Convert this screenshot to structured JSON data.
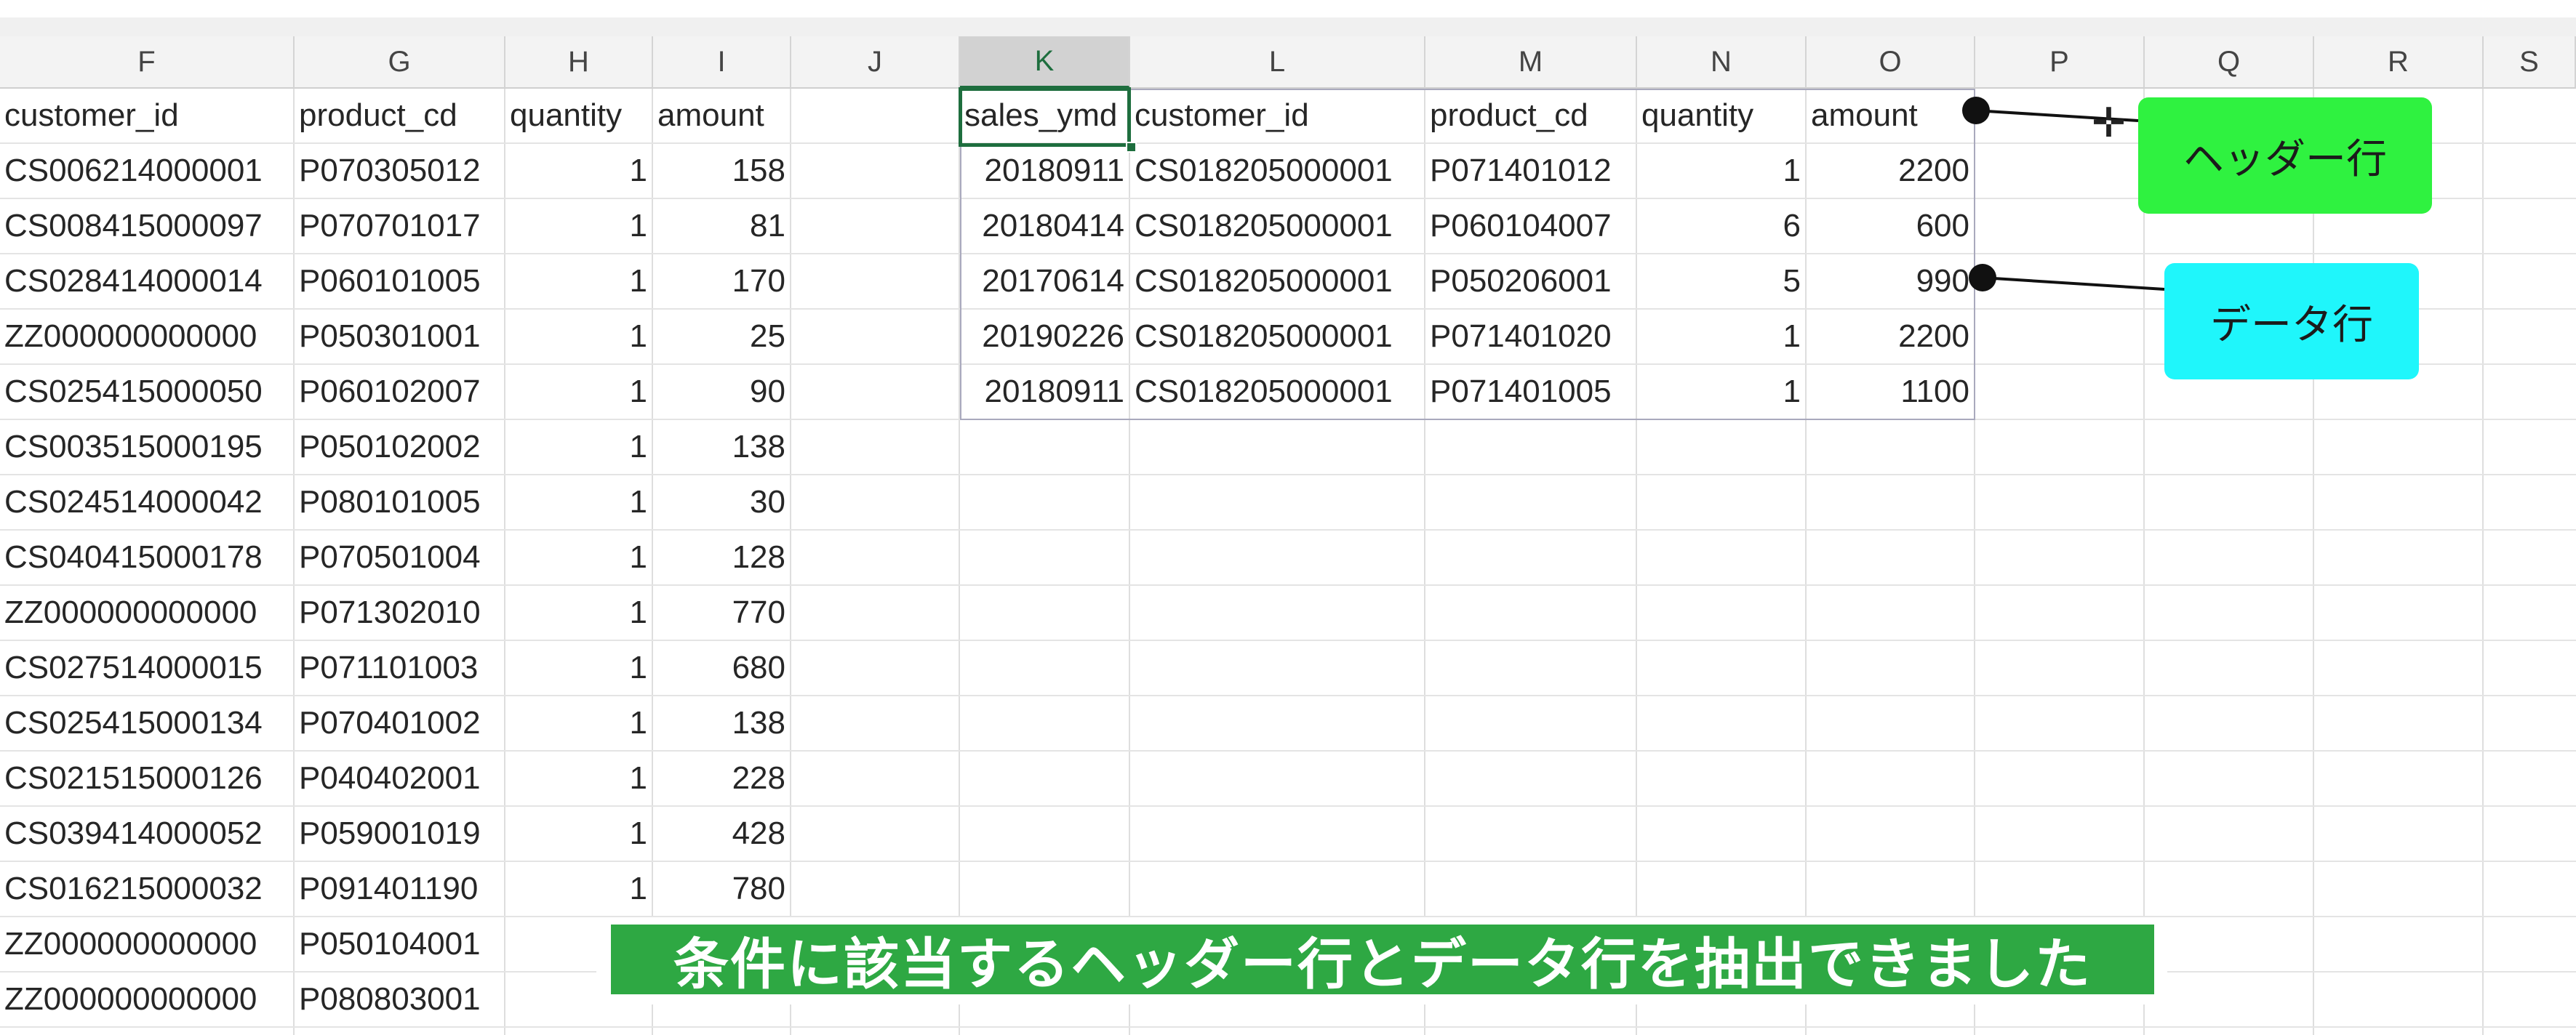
{
  "column_headers": [
    "F",
    "G",
    "H",
    "I",
    "J",
    "K",
    "L",
    "M",
    "N",
    "O",
    "P",
    "Q",
    "R",
    "S"
  ],
  "selected_column": "K",
  "left_table": {
    "headers": [
      "customer_id",
      "product_cd",
      "quantity",
      "amount"
    ],
    "rows": [
      [
        "CS006214000001",
        "P070305012",
        "1",
        "158"
      ],
      [
        "CS008415000097",
        "P070701017",
        "1",
        "81"
      ],
      [
        "CS028414000014",
        "P060101005",
        "1",
        "170"
      ],
      [
        "ZZ000000000000",
        "P050301001",
        "1",
        "25"
      ],
      [
        "CS025415000050",
        "P060102007",
        "1",
        "90"
      ],
      [
        "CS003515000195",
        "P050102002",
        "1",
        "138"
      ],
      [
        "CS024514000042",
        "P080101005",
        "1",
        "30"
      ],
      [
        "CS040415000178",
        "P070501004",
        "1",
        "128"
      ],
      [
        "ZZ000000000000",
        "P071302010",
        "1",
        "770"
      ],
      [
        "CS027514000015",
        "P071101003",
        "1",
        "680"
      ],
      [
        "CS025415000134",
        "P070401002",
        "1",
        "138"
      ],
      [
        "CS021515000126",
        "P040402001",
        "1",
        "228"
      ],
      [
        "CS039414000052",
        "P059001019",
        "1",
        "428"
      ],
      [
        "CS016215000032",
        "P091401190",
        "1",
        "780"
      ],
      [
        "ZZ000000000000",
        "P050104001",
        "",
        ""
      ],
      [
        "ZZ000000000000",
        "P080803001",
        "",
        ""
      ]
    ]
  },
  "right_table": {
    "headers": [
      "sales_ymd",
      "customer_id",
      "product_cd",
      "quantity",
      "amount"
    ],
    "rows": [
      [
        "20180911",
        "CS018205000001",
        "P071401012",
        "1",
        "2200"
      ],
      [
        "20180414",
        "CS018205000001",
        "P060104007",
        "6",
        "600"
      ],
      [
        "20170614",
        "CS018205000001",
        "P050206001",
        "5",
        "990"
      ],
      [
        "20190226",
        "CS018205000001",
        "P071401020",
        "1",
        "2200"
      ],
      [
        "20180911",
        "CS018205000001",
        "P071401005",
        "1",
        "1100"
      ]
    ]
  },
  "callouts": {
    "header_row": "ヘッダー行",
    "data_row": "データ行"
  },
  "caption": "条件に該当するヘッダー行とデータ行を抽出できました",
  "icons": {
    "cursor": "cell-select-cursor-icon"
  },
  "colors": {
    "header_callout": "#2ff240",
    "data_callout": "#1ff6fb",
    "caption_bg": "#2ea843",
    "excel_green": "#1e6e3e"
  }
}
